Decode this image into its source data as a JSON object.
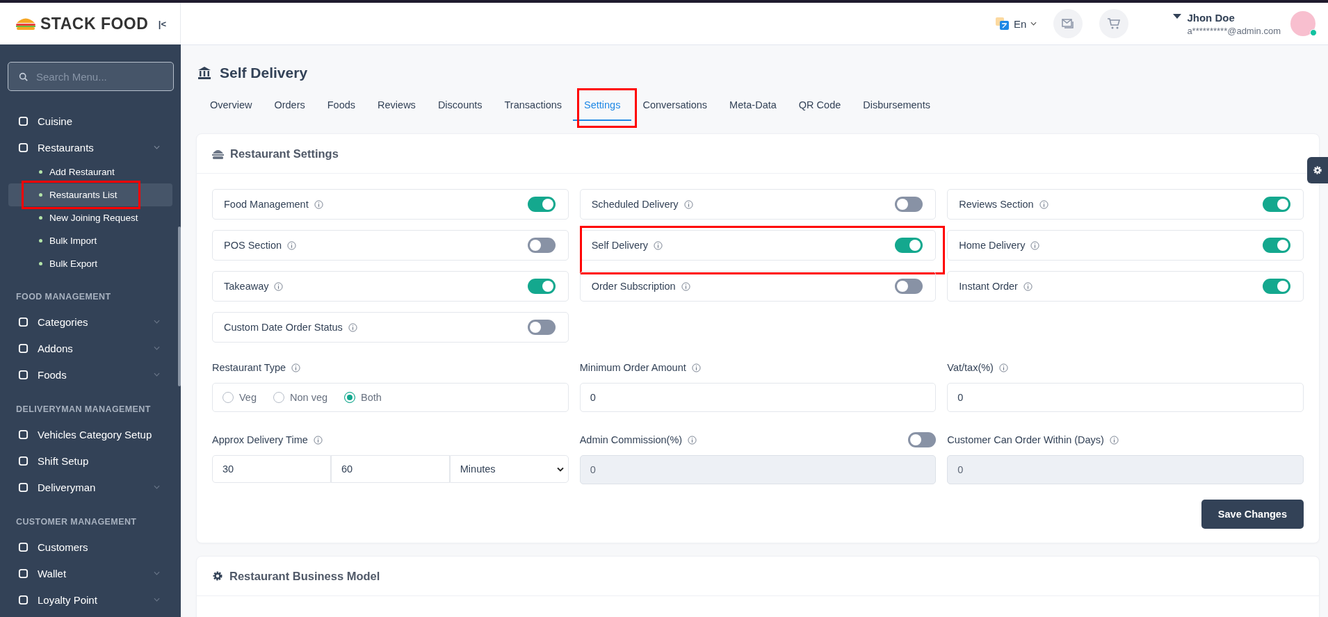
{
  "brand": {
    "logo_text": "STACK FOOD",
    "collapse_glyph": "|<"
  },
  "sidebar": {
    "search": {
      "placeholder": "Search Menu..."
    },
    "groups": [
      {
        "items": [
          {
            "label": "Cuisine",
            "expandable": false
          },
          {
            "label": "Restaurants",
            "expandable": true,
            "expanded": true,
            "children": [
              {
                "label": "Add Restaurant",
                "selected": false,
                "highlighted": false
              },
              {
                "label": "Restaurants List",
                "selected": true,
                "highlighted": true
              },
              {
                "label": "New Joining Request",
                "selected": false,
                "highlighted": false
              },
              {
                "label": "Bulk Import",
                "selected": false,
                "highlighted": false
              },
              {
                "label": "Bulk Export",
                "selected": false,
                "highlighted": false
              }
            ]
          }
        ]
      },
      {
        "heading": "FOOD MANAGEMENT",
        "items": [
          {
            "label": "Categories",
            "expandable": true,
            "expanded": false
          },
          {
            "label": "Addons",
            "expandable": true,
            "expanded": false
          },
          {
            "label": "Foods",
            "expandable": true,
            "expanded": false
          }
        ]
      },
      {
        "heading": "DELIVERYMAN MANAGEMENT",
        "items": [
          {
            "label": "Vehicles Category Setup",
            "expandable": false
          },
          {
            "label": "Shift Setup",
            "expandable": false
          },
          {
            "label": "Deliveryman",
            "expandable": true,
            "expanded": false
          }
        ]
      },
      {
        "heading": "CUSTOMER MANAGEMENT",
        "items": [
          {
            "label": "Customers",
            "expandable": false
          },
          {
            "label": "Wallet",
            "expandable": true,
            "expanded": false
          },
          {
            "label": "Loyalty Point",
            "expandable": true,
            "expanded": false
          }
        ]
      }
    ]
  },
  "header": {
    "language": "En",
    "user": {
      "name": "Jhon Doe",
      "email": "a**********@admin.com",
      "online": true
    }
  },
  "page": {
    "title": "Self Delivery",
    "tabs": [
      {
        "label": "Overview",
        "selected": false,
        "highlighted": false
      },
      {
        "label": "Orders",
        "selected": false,
        "highlighted": false
      },
      {
        "label": "Foods",
        "selected": false,
        "highlighted": false
      },
      {
        "label": "Reviews",
        "selected": false,
        "highlighted": false
      },
      {
        "label": "Discounts",
        "selected": false,
        "highlighted": false
      },
      {
        "label": "Transactions",
        "selected": false,
        "highlighted": false
      },
      {
        "label": "Settings",
        "selected": true,
        "highlighted": true
      },
      {
        "label": "Conversations",
        "selected": false,
        "highlighted": false
      },
      {
        "label": "Meta-Data",
        "selected": false,
        "highlighted": false
      },
      {
        "label": "QR Code",
        "selected": false,
        "highlighted": false
      },
      {
        "label": "Disbursements",
        "selected": false,
        "highlighted": false
      }
    ]
  },
  "settings_card": {
    "title": "Restaurant Settings",
    "toggles": [
      {
        "label": "Food Management",
        "on": true,
        "highlighted": false
      },
      {
        "label": "Scheduled Delivery",
        "on": false,
        "highlighted": false
      },
      {
        "label": "Reviews Section",
        "on": true,
        "highlighted": false
      },
      {
        "label": "POS Section",
        "on": false,
        "highlighted": false
      },
      {
        "label": "Self Delivery",
        "on": true,
        "highlighted": true
      },
      {
        "label": "Home Delivery",
        "on": true,
        "highlighted": false
      },
      {
        "label": "Takeaway",
        "on": true,
        "highlighted": false
      },
      {
        "label": "Order Subscription",
        "on": false,
        "highlighted": false
      },
      {
        "label": "Instant Order",
        "on": true,
        "highlighted": false
      },
      {
        "label": "Custom Date Order Status",
        "on": false,
        "highlighted": false
      }
    ],
    "fields": [
      {
        "kind": "radio",
        "label": "Restaurant Type",
        "options": [
          {
            "label": "Veg",
            "selected": false
          },
          {
            "label": "Non veg",
            "selected": false
          },
          {
            "label": "Both",
            "selected": true
          }
        ]
      },
      {
        "kind": "text",
        "label": "Minimum Order Amount",
        "value": "0",
        "disabled": false
      },
      {
        "kind": "text",
        "label": "Vat/tax(%)",
        "value": "0",
        "disabled": false
      },
      {
        "kind": "range",
        "label": "Approx Delivery Time",
        "min": "30",
        "max": "60",
        "unit": "Minutes"
      },
      {
        "kind": "text",
        "label": "Admin Commission(%)",
        "value": "0",
        "disabled": true,
        "toggle_on": false
      },
      {
        "kind": "text",
        "label": "Customer Can Order Within (Days)",
        "value": "0",
        "disabled": true
      }
    ],
    "save_button": "Save Changes"
  },
  "business_card": {
    "title": "Restaurant Business Model"
  }
}
